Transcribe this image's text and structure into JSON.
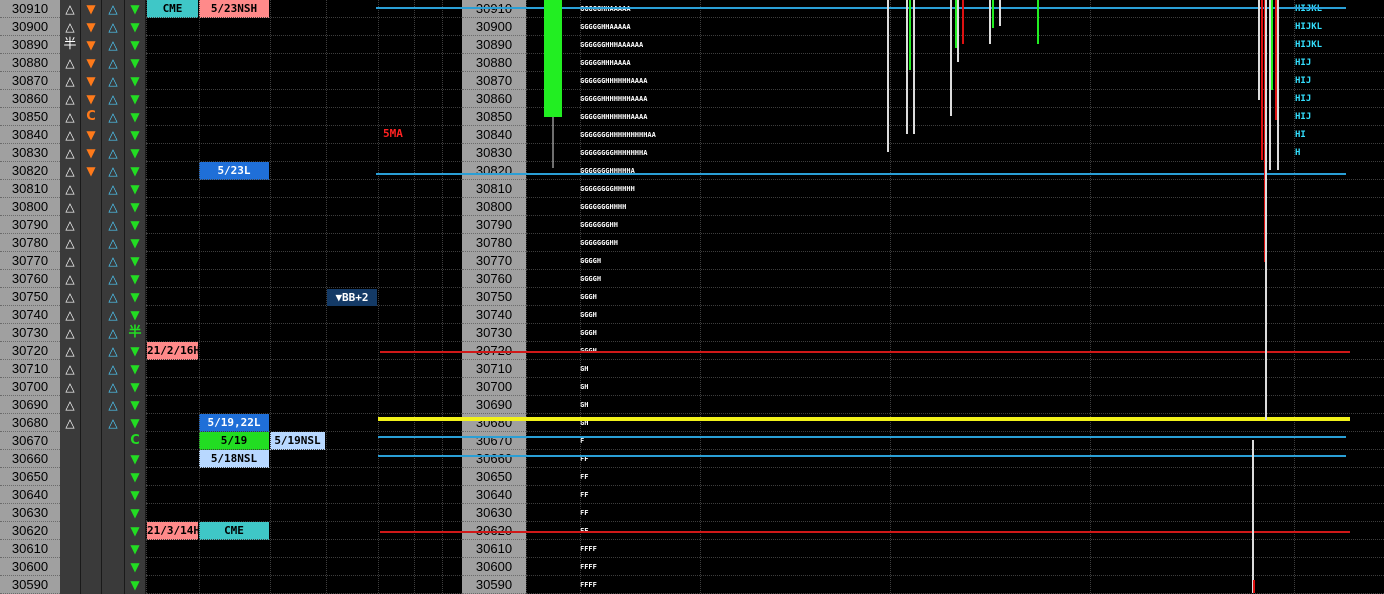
{
  "prices": [
    30910,
    30900,
    30890,
    30880,
    30870,
    30860,
    30850,
    30840,
    30830,
    30820,
    30810,
    30800,
    30790,
    30780,
    30770,
    30760,
    30750,
    30740,
    30730,
    30720,
    30710,
    30700,
    30690,
    30680,
    30670,
    30660,
    30650,
    30640,
    30630,
    30620,
    30610,
    30600,
    30590
  ],
  "columns": {
    "colA": [
      "up",
      "up",
      "han",
      "up",
      "up",
      "up",
      "up",
      "up",
      "up",
      "up",
      "up",
      "up",
      "up",
      "up",
      "up",
      "up",
      "up",
      "up",
      "up",
      "up",
      "up",
      "up",
      "up",
      "up",
      "",
      "",
      "",
      "",
      "",
      "",
      "",
      "",
      ""
    ],
    "colB": [
      "down",
      "down",
      "down",
      "down",
      "down",
      "down",
      "C",
      "down",
      "down",
      "down",
      "",
      "",
      "",
      "",
      "",
      "",
      "",
      "",
      "",
      "",
      "",
      "",
      "",
      "",
      "",
      "",
      "",
      "",
      "",
      "",
      "",
      "",
      ""
    ],
    "colC": [
      "upc",
      "upc",
      "upc",
      "upc",
      "upc",
      "upc",
      "upc",
      "upc",
      "upc",
      "upc",
      "upc",
      "upc",
      "upc",
      "upc",
      "upc",
      "upc",
      "upc",
      "upc",
      "upc",
      "upc",
      "upc",
      "upc",
      "upc",
      "upc",
      "",
      "",
      "",
      "",
      "",
      "",
      "",
      "",
      ""
    ],
    "colD": [
      "downg",
      "downg",
      "downg",
      "downg",
      "downg",
      "downg",
      "downg",
      "downg",
      "downg",
      "downg",
      "downg",
      "downg",
      "downg",
      "downg",
      "downg",
      "downg",
      "downg",
      "downg",
      "han",
      "downg",
      "downg",
      "downg",
      "downg",
      "downg",
      "C",
      "downg",
      "downg",
      "downg",
      "downg",
      "downg",
      "downg",
      "downg",
      "downg"
    ]
  },
  "symbols": {
    "up": "△",
    "down": "▼",
    "upc": "△",
    "downg": "▼",
    "han": "半",
    "C": "C"
  },
  "tags": [
    {
      "row": 0,
      "col": "t1",
      "text": "CME",
      "bg": "#3fc7c7",
      "fg": "#000"
    },
    {
      "row": 0,
      "col": "t2",
      "text": "5/23NSH",
      "bg": "#ff8a8a",
      "fg": "#000"
    },
    {
      "row": 9,
      "col": "t2",
      "text": "5/23L",
      "bg": "#1f6fd8",
      "fg": "#fff"
    },
    {
      "row": 19,
      "col": "t1",
      "text": "21/2/16H",
      "bg": "#ff8a8a",
      "fg": "#000"
    },
    {
      "row": 23,
      "col": "t2",
      "text": "5/19,22L",
      "bg": "#1f6fd8",
      "fg": "#fff"
    },
    {
      "row": 24,
      "col": "t2",
      "text": "5/19",
      "bg": "#22dd22",
      "fg": "#000"
    },
    {
      "row": 24,
      "col": "t3",
      "text": "5/19NSL",
      "bg": "#b8d8ff",
      "fg": "#000"
    },
    {
      "row": 25,
      "col": "t2",
      "text": "5/18NSL",
      "bg": "#b8d8ff",
      "fg": "#000"
    },
    {
      "row": 29,
      "col": "t1",
      "text": "21/3/14H",
      "bg": "#ff8a8a",
      "fg": "#000"
    },
    {
      "row": 29,
      "col": "t2",
      "text": "CME",
      "bg": "#3fc7c7",
      "fg": "#000"
    }
  ],
  "ma_label": "5MA",
  "bb_label": "▼BB+2",
  "tpo_left": [
    "GGGGGHHAAAAA",
    "GGGGGHHAAAAA",
    "GGGGGGHHHAAAAAA",
    "GGGGGHHHAAAA",
    "GGGGGGHHHHHHAAAA",
    "GGGGGHHHHHHHAAAA",
    "GGGGGHHHHHHHAAAA",
    "GGGGGGGHHHHHHHHHAA",
    "GGGGGGGGHHHHHHHA",
    "GGGGGGGHHHHHA",
    "GGGGGGGGHHHHH",
    "GGGGGGGHHHH",
    "GGGGGGGHH",
    "GGGGGGGHH",
    "GGGGH",
    "GGGGH",
    "GGGH",
    "GGGH",
    "GGGH",
    "GGGH",
    "GH",
    "GH",
    "GH",
    "GH",
    "F",
    "FF",
    "FF",
    "FF",
    "FF",
    "FF",
    "FFFF",
    "FFFF",
    "FFFF"
  ],
  "tpo_right": [
    "HIJKL",
    "HIJKL",
    "HIJKL",
    "HIJ",
    "HIJ",
    "HIJ",
    "HIJ",
    "HI",
    "H",
    "",
    "",
    "",
    "",
    "",
    "",
    "",
    "",
    "",
    "",
    "",
    "",
    "",
    "",
    "",
    "",
    "",
    "",
    "",
    "",
    "",
    "",
    "",
    ""
  ],
  "colors": {
    "price_bg": "#a0a0a0",
    "blue_line": "#2a9fd6",
    "red_line": "#d01818",
    "yellow_line": "#f2f21a",
    "candle_green": "#22ee22",
    "candle_red": "#dd1111"
  }
}
